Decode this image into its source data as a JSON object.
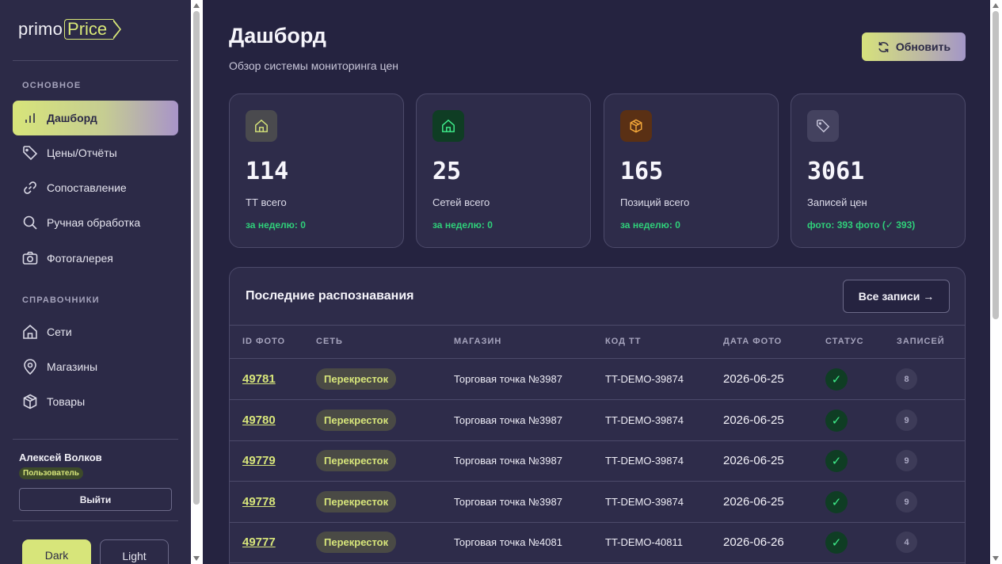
{
  "logo": {
    "part1": "primo",
    "part2": "Price"
  },
  "sidebar": {
    "section_main": "ОСНОВНОЕ",
    "section_refs": "СПРАВОЧНИКИ",
    "items": [
      {
        "label": "Дашборд",
        "icon": "bar-chart-icon"
      },
      {
        "label": "Цены/Отчёты",
        "icon": "tag-icon"
      },
      {
        "label": "Сопоставление",
        "icon": "link-icon"
      },
      {
        "label": "Ручная обработка",
        "icon": "search-icon"
      },
      {
        "label": "Фотогалерея",
        "icon": "camera-icon"
      },
      {
        "label": "Сети",
        "icon": "home-icon"
      },
      {
        "label": "Магазины",
        "icon": "map-pin-icon"
      },
      {
        "label": "Товары",
        "icon": "box-icon"
      }
    ],
    "user": {
      "name": "Алексей Волков",
      "role": "Пользователь"
    },
    "logout": "Выйти",
    "theme": {
      "dark": "Dark",
      "light": "Light",
      "selected": "Dark"
    }
  },
  "header": {
    "title": "Дашборд",
    "subtitle": "Обзор системы мониторинга цен",
    "refresh": "Обновить"
  },
  "stats": [
    {
      "value": "114",
      "label": "ТТ всего",
      "note": "за неделю: 0",
      "icon": "home-icon"
    },
    {
      "value": "25",
      "label": "Сетей всего",
      "note": "за неделю: 0",
      "icon": "home-icon"
    },
    {
      "value": "165",
      "label": "Позиций всего",
      "note": "за неделю: 0",
      "icon": "box-icon"
    },
    {
      "value": "3061",
      "label": "Записей цен",
      "note": "фото: 393 фото (✓ 393)",
      "icon": "tag-icon"
    }
  ],
  "recent": {
    "title": "Последние распознавания",
    "all_button": "Все записи →",
    "columns": [
      "ID ФОТО",
      "СЕТЬ",
      "МАГАЗИН",
      "КОД ТТ",
      "ДАТА ФОТО",
      "СТАТУС",
      "ЗАПИСЕЙ"
    ],
    "rows": [
      {
        "id": "49781",
        "network": "Перекресток",
        "store": "Торговая точка №3987",
        "code": "TT-DEMO-39874",
        "date": "2026-06-25",
        "status": "✓",
        "count": "8"
      },
      {
        "id": "49780",
        "network": "Перекресток",
        "store": "Торговая точка №3987",
        "code": "TT-DEMO-39874",
        "date": "2026-06-25",
        "status": "✓",
        "count": "9"
      },
      {
        "id": "49779",
        "network": "Перекресток",
        "store": "Торговая точка №3987",
        "code": "TT-DEMO-39874",
        "date": "2026-06-25",
        "status": "✓",
        "count": "9"
      },
      {
        "id": "49778",
        "network": "Перекресток",
        "store": "Торговая точка №3987",
        "code": "TT-DEMO-39874",
        "date": "2026-06-25",
        "status": "✓",
        "count": "9"
      },
      {
        "id": "49777",
        "network": "Перекресток",
        "store": "Торговая точка №4081",
        "code": "TT-DEMO-40811",
        "date": "2026-06-26",
        "status": "✓",
        "count": "4"
      }
    ]
  }
}
